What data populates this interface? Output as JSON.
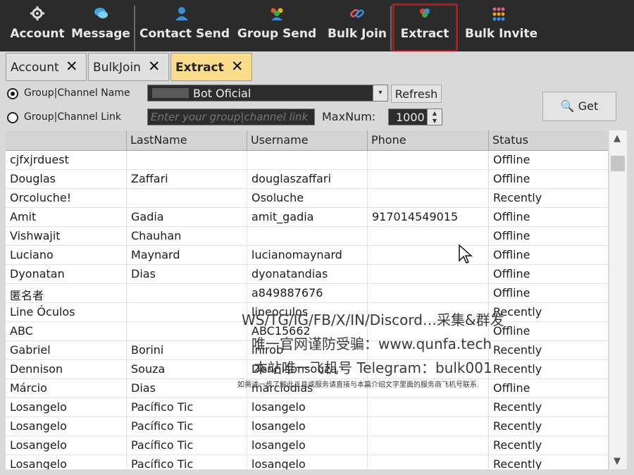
{
  "nav": {
    "items": [
      {
        "label": "Account",
        "icon": "gear-icon"
      },
      {
        "label": "Message",
        "icon": "chat-icon"
      },
      {
        "label": "Contact Send",
        "icon": "person-icon"
      },
      {
        "label": "Group Send",
        "icon": "group-icon"
      },
      {
        "label": "Bulk Join",
        "icon": "link-icon"
      },
      {
        "label": "Extract",
        "icon": "extract-icon"
      },
      {
        "label": "Bulk Invite",
        "icon": "invite-icon"
      }
    ],
    "highlight_color": "#c0141c"
  },
  "tabs": [
    {
      "label": "Account",
      "close": "✕",
      "active": false
    },
    {
      "label": "BulkJoin",
      "close": "✕",
      "active": false
    },
    {
      "label": "Extract",
      "close": "✕",
      "active": true
    }
  ],
  "form": {
    "radio_name_label": "Group|Channel Name",
    "radio_link_label": "Group|Channel Link",
    "name_selected": "Bot Oficial",
    "link_placeholder": "Enter your group|channel link",
    "refresh_label": "Refresh",
    "maxnum_label": "MaxNum:",
    "maxnum_value": "1000",
    "get_label": "Get"
  },
  "table": {
    "columns": [
      "",
      "LastName",
      "Username",
      "Phone",
      "Status"
    ],
    "rows": [
      [
        "cjfxjrduest",
        "",
        "",
        "",
        "Offline"
      ],
      [
        "Douglas",
        "Zaffari",
        "douglaszaffari",
        "",
        "Offline"
      ],
      [
        "Orcoluche!",
        "",
        "Osoluche",
        "",
        "Recently"
      ],
      [
        "Amit",
        "Gadia",
        "amit_gadia",
        "917014549015",
        "Offline"
      ],
      [
        "Vishwajit",
        "Chauhan",
        "",
        "",
        "Offline"
      ],
      [
        "Luciano",
        "Maynard",
        "lucianomaynard",
        "",
        "Offline"
      ],
      [
        "Dyonatan",
        "Dias",
        "dyonatandias",
        "",
        "Offline"
      ],
      [
        "匿名者",
        "",
        "a849887676",
        "",
        "Offline"
      ],
      [
        "Line Óculos",
        "",
        "lineoculos",
        "",
        "Recently"
      ],
      [
        "ABC",
        "",
        "ABC15662",
        "",
        "Offline"
      ],
      [
        "Gabriel",
        "Borini",
        "inirob",
        "",
        "Recently"
      ],
      [
        "Dennison",
        "Souza",
        "Dennisonsouza",
        "",
        "Recently"
      ],
      [
        "Márcio",
        "Dias",
        "marciodias",
        "",
        "Offline"
      ],
      [
        "Losangelo",
        "Pacífico Tic",
        "losangelo",
        "",
        "Recently"
      ],
      [
        "Losangelo",
        "Pacífico Tic",
        "losangelo",
        "",
        "Recently"
      ],
      [
        "Losangelo",
        "Pacífico Tic",
        "losangelo",
        "",
        "Recently"
      ],
      [
        "Losangelo",
        "Pacífico Tic",
        "losangelo",
        "",
        "Recently"
      ]
    ]
  },
  "watermark": {
    "line1": "WS/TG/IG/FB/X/IN/Discord…采集&群发",
    "line2": "唯一官网谨防受骗：www.qunfa.tech",
    "line3": "本站唯一飞机号 Telegram：bulk001",
    "line4": "如需进一步了解此工具或服务请直接与本篇介绍文字里面的服务商飞机号联系"
  }
}
